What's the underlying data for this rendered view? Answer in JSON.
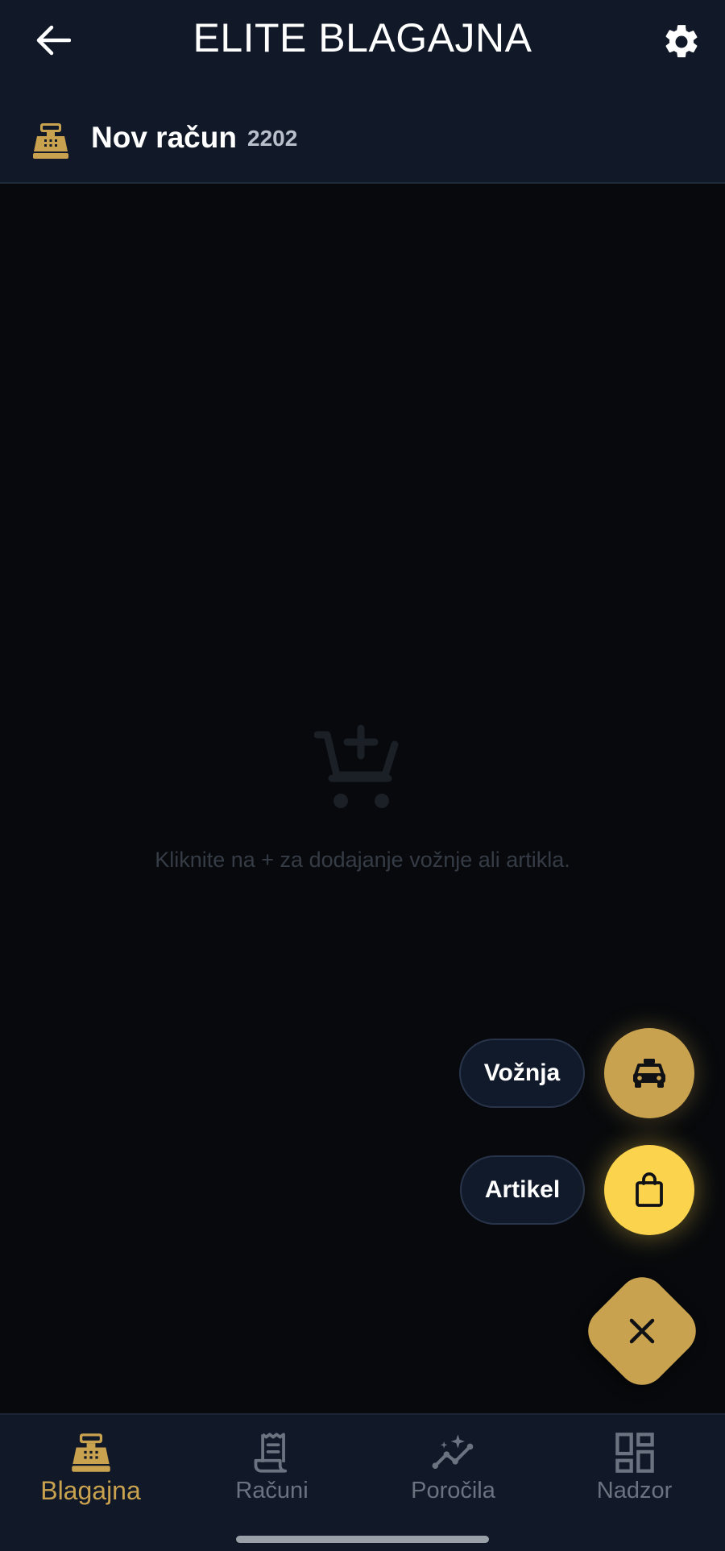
{
  "header": {
    "title": "ELITE BLAGAJNA",
    "back_icon": "arrow-back-icon",
    "settings_icon": "gear-icon"
  },
  "receipt": {
    "icon": "cash-register-icon",
    "title": "Nov račun",
    "number": "2202"
  },
  "empty_state": {
    "icon": "add-cart-icon",
    "message": "Kliknite na + za dodajanje vožnje ali artikla."
  },
  "speed_dial": {
    "items": [
      {
        "label": "Vožnja",
        "icon": "taxi-icon"
      },
      {
        "label": "Artikel",
        "icon": "shopping-bag-icon"
      }
    ],
    "close_icon": "close-icon"
  },
  "bottom_nav": {
    "items": [
      {
        "label": "Blagajna",
        "icon": "cash-register-icon",
        "active": true
      },
      {
        "label": "Računi",
        "icon": "receipt-icon",
        "active": false
      },
      {
        "label": "Poročila",
        "icon": "trend-chart-icon",
        "active": false
      },
      {
        "label": "Nadzor",
        "icon": "dashboard-icon",
        "active": false
      }
    ]
  },
  "colors": {
    "accent": "#c9a24f",
    "accent_bright": "#fcd34d",
    "surface": "#111827",
    "background": "#07090c"
  }
}
